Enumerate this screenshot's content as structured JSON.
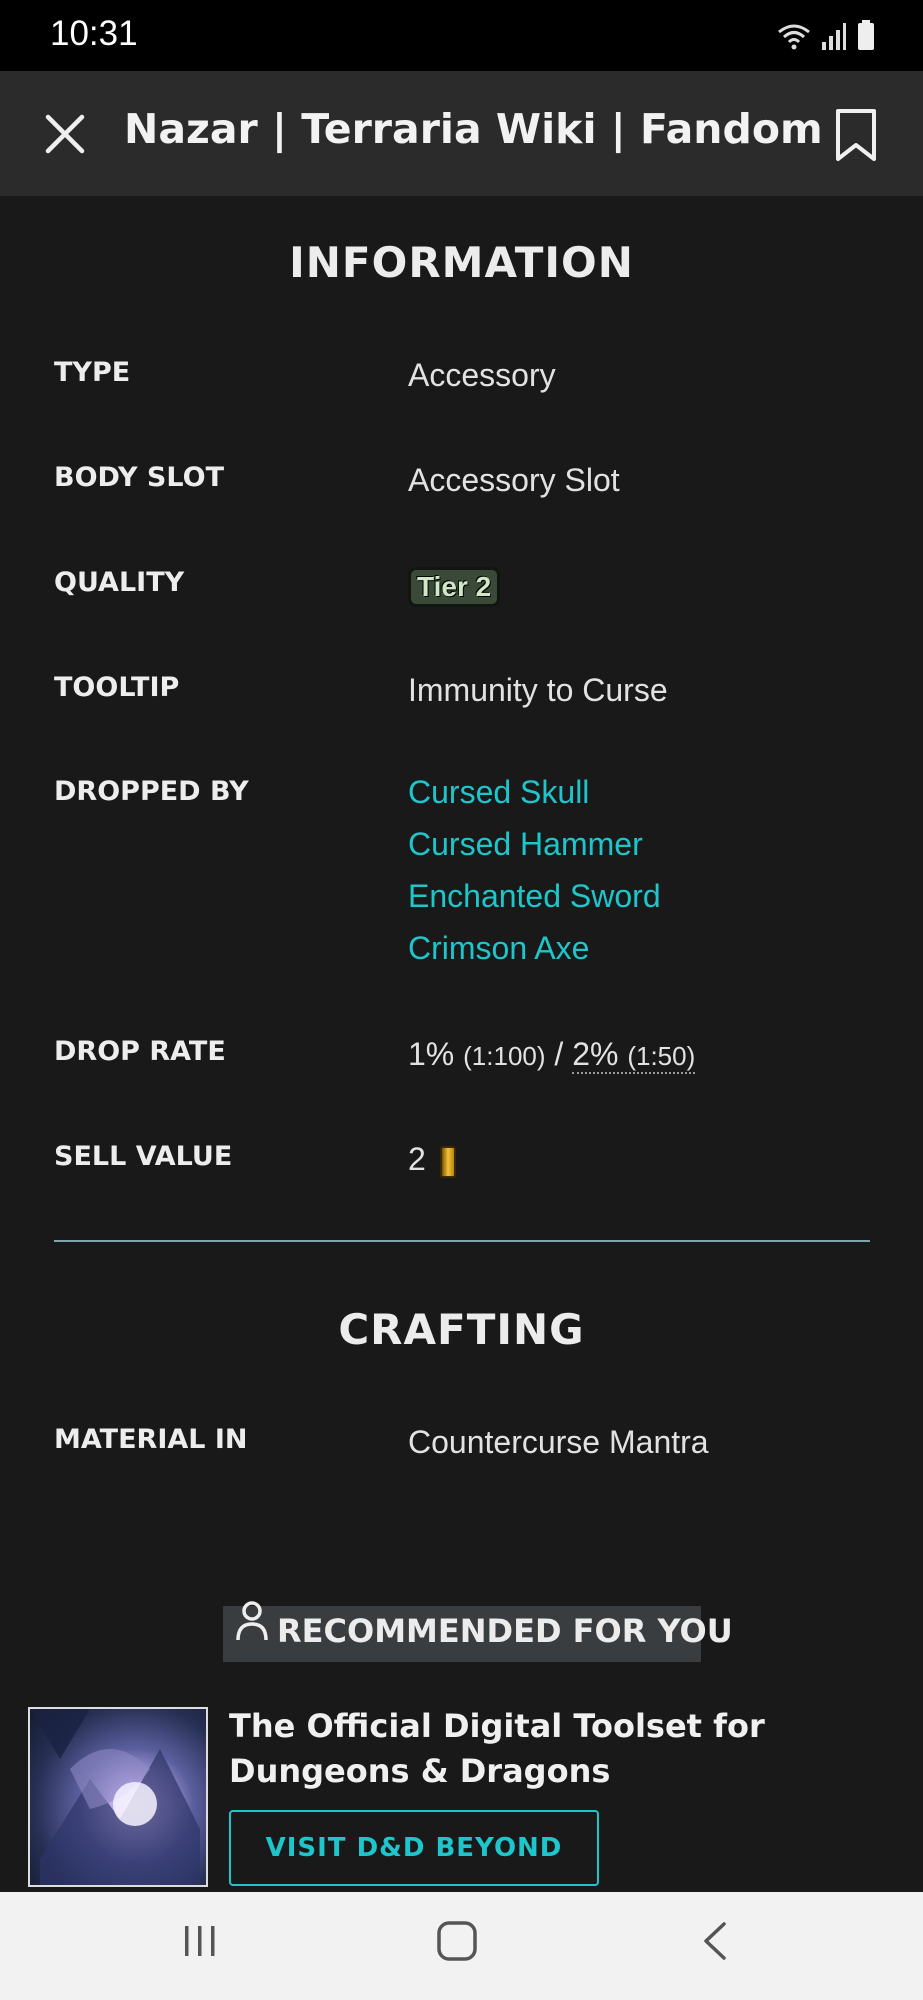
{
  "status_bar": {
    "time": "10:31"
  },
  "app_bar": {
    "title": "Nazar | Terraria Wiki | Fandom"
  },
  "information": {
    "heading": "INFORMATION",
    "type": {
      "label": "TYPE",
      "value": "Accessory"
    },
    "body_slot": {
      "label": "BODY SLOT",
      "value": "Accessory Slot"
    },
    "quality": {
      "label": "QUALITY",
      "badge": "Tier 2"
    },
    "tooltip": {
      "label": "TOOLTIP",
      "value": "Immunity to Curse"
    },
    "dropped_by": {
      "label": "DROPPED BY",
      "items": [
        "Cursed Skull",
        "Cursed Hammer",
        "Enchanted Sword",
        "Crimson Axe"
      ]
    },
    "drop_rate": {
      "label": "DROP RATE",
      "rate1": "1%",
      "ratio1": "(1:100)",
      "sep": "/",
      "rate2": "2%",
      "ratio2": "(1:50)"
    },
    "sell_value": {
      "label": "SELL VALUE",
      "value": "2"
    }
  },
  "crafting": {
    "heading": "CRAFTING",
    "material_in": {
      "label": "MATERIAL IN",
      "value": "Countercurse Mantra"
    }
  },
  "recommended": {
    "heading": "RECOMMENDED FOR YOU",
    "promo_title": "The Official Digital Toolset for Dungeons & Dragons",
    "button": "VISIT D&D BEYOND"
  },
  "colors": {
    "link": "#1ec6cc",
    "background": "#191919",
    "appbar": "#2b2b2b"
  }
}
